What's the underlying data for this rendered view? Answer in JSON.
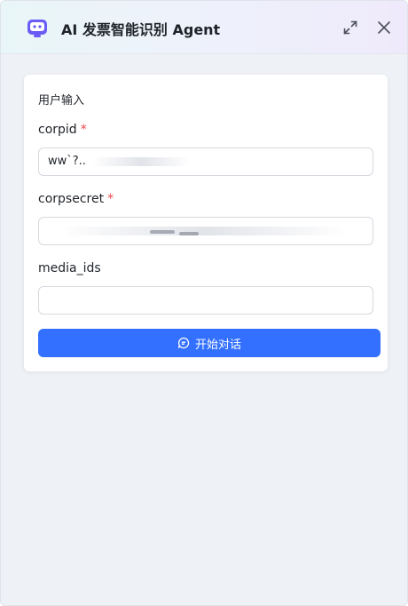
{
  "header": {
    "title": "AI 发票智能识别 Agent",
    "expand_icon": "expand-icon",
    "close_icon": "close-icon"
  },
  "form": {
    "section_title": "用户输入",
    "fields": [
      {
        "label": "corpid",
        "required": "*",
        "value": "ww`?.."
      },
      {
        "label": "corpsecret",
        "required": "*",
        "value": ""
      },
      {
        "label": "media_ids",
        "required": "",
        "value": ""
      }
    ],
    "submit_label": "开始对话",
    "submit_icon": "chat-bubble-icon"
  },
  "colors": {
    "accent": "#3370ff",
    "required": "#e5484d",
    "background": "#eef1f5"
  }
}
